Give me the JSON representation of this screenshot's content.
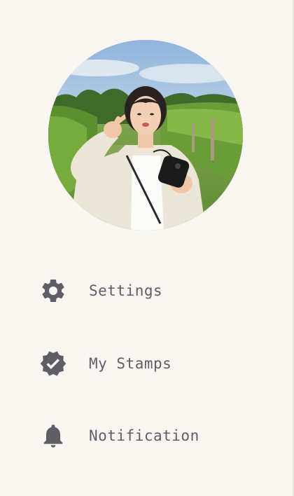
{
  "profile": {
    "avatar_icon": "user-photo"
  },
  "menu": {
    "items": [
      {
        "label": "Settings",
        "icon": "gear-icon"
      },
      {
        "label": "My Stamps",
        "icon": "verified-badge-icon"
      },
      {
        "label": "Notification",
        "icon": "bell-icon"
      }
    ]
  },
  "colors": {
    "background": "#f9f5f0",
    "text": "#5f5d66",
    "icon": "#5f5d66"
  }
}
